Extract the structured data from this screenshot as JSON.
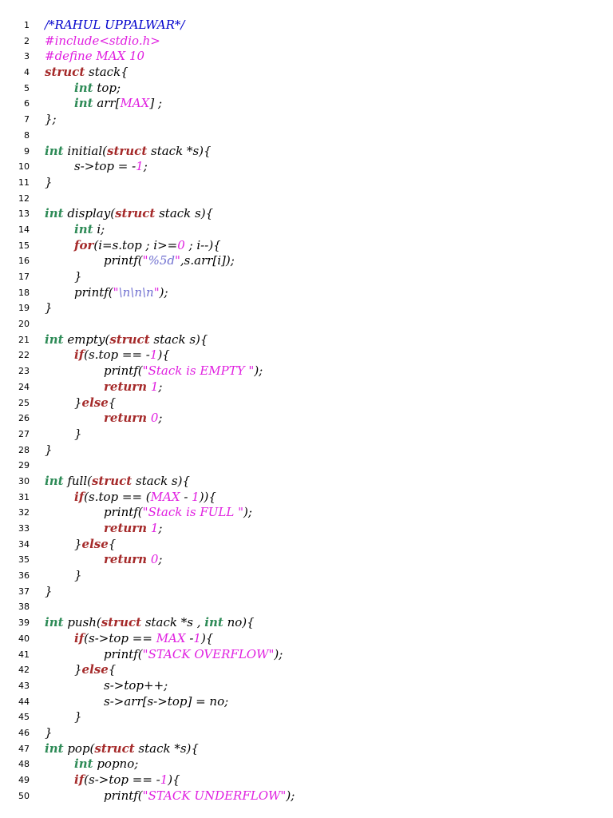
{
  "colors": {
    "background": "#ffffff",
    "line_number": "#000000",
    "plain": "#000000",
    "kw": "#2e8b57",
    "kw2": "#a52a2a",
    "mac": "#e020e0",
    "str": "#e020e0",
    "num": "#e020e0",
    "cmt": "#0000cc",
    "esc": "#7070d0"
  },
  "lines": [
    {
      "n": "1",
      "indent": 0,
      "tokens": [
        [
          "cmt",
          "/*RAHUL UPPALWAR*/"
        ]
      ]
    },
    {
      "n": "2",
      "indent": 0,
      "tokens": [
        [
          "mac",
          "#include<stdio.h>"
        ]
      ]
    },
    {
      "n": "3",
      "indent": 0,
      "tokens": [
        [
          "mac",
          "#define MAX 10"
        ]
      ]
    },
    {
      "n": "4",
      "indent": 0,
      "tokens": [
        [
          "kw2",
          "struct"
        ],
        [
          "p",
          " stack{"
        ]
      ]
    },
    {
      "n": "5",
      "indent": 1,
      "tokens": [
        [
          "kw",
          "int"
        ],
        [
          "p",
          " top;"
        ]
      ]
    },
    {
      "n": "6",
      "indent": 1,
      "tokens": [
        [
          "kw",
          "int"
        ],
        [
          "p",
          " arr["
        ],
        [
          "mac",
          "MAX"
        ],
        [
          "p",
          "] ;"
        ]
      ]
    },
    {
      "n": "7",
      "indent": 0,
      "tokens": [
        [
          "p",
          "};"
        ]
      ]
    },
    {
      "n": "8",
      "indent": 0,
      "tokens": []
    },
    {
      "n": "9",
      "indent": 0,
      "tokens": [
        [
          "kw",
          "int"
        ],
        [
          "p",
          " initial("
        ],
        [
          "kw2",
          "struct"
        ],
        [
          "p",
          " stack *s){"
        ]
      ]
    },
    {
      "n": "10",
      "indent": 1,
      "tokens": [
        [
          "p",
          "s->top = -"
        ],
        [
          "num",
          "1"
        ],
        [
          "p",
          ";"
        ]
      ]
    },
    {
      "n": "11",
      "indent": 0,
      "tokens": [
        [
          "p",
          "}"
        ]
      ]
    },
    {
      "n": "12",
      "indent": 0,
      "tokens": []
    },
    {
      "n": "13",
      "indent": 0,
      "tokens": [
        [
          "kw",
          "int"
        ],
        [
          "p",
          " display("
        ],
        [
          "kw2",
          "struct"
        ],
        [
          "p",
          " stack s){"
        ]
      ]
    },
    {
      "n": "14",
      "indent": 1,
      "tokens": [
        [
          "kw",
          "int"
        ],
        [
          "p",
          " i;"
        ]
      ]
    },
    {
      "n": "15",
      "indent": 1,
      "tokens": [
        [
          "kw2",
          "for"
        ],
        [
          "p",
          "(i=s.top ; i>="
        ],
        [
          "num",
          "0"
        ],
        [
          "p",
          " ; i--){"
        ]
      ]
    },
    {
      "n": "16",
      "indent": 2,
      "tokens": [
        [
          "p",
          "printf("
        ],
        [
          "str",
          "\""
        ],
        [
          "esc",
          "%5d"
        ],
        [
          "str",
          "\""
        ],
        [
          "p",
          ",s.arr[i]);"
        ]
      ]
    },
    {
      "n": "17",
      "indent": 1,
      "tokens": [
        [
          "p",
          "}"
        ]
      ]
    },
    {
      "n": "18",
      "indent": 1,
      "tokens": [
        [
          "p",
          "printf("
        ],
        [
          "str",
          "\""
        ],
        [
          "esc",
          "\\n\\n\\n"
        ],
        [
          "str",
          "\""
        ],
        [
          "p",
          ");"
        ]
      ]
    },
    {
      "n": "19",
      "indent": 0,
      "tokens": [
        [
          "p",
          "}"
        ]
      ]
    },
    {
      "n": "20",
      "indent": 0,
      "tokens": []
    },
    {
      "n": "21",
      "indent": 0,
      "tokens": [
        [
          "kw",
          "int"
        ],
        [
          "p",
          " empty("
        ],
        [
          "kw2",
          "struct"
        ],
        [
          "p",
          " stack s){"
        ]
      ]
    },
    {
      "n": "22",
      "indent": 1,
      "tokens": [
        [
          "kw2",
          "if"
        ],
        [
          "p",
          "(s.top == -"
        ],
        [
          "num",
          "1"
        ],
        [
          "p",
          "){"
        ]
      ]
    },
    {
      "n": "23",
      "indent": 2,
      "tokens": [
        [
          "p",
          "printf("
        ],
        [
          "str",
          "\"Stack is EMPTY \""
        ],
        [
          "p",
          ");"
        ]
      ]
    },
    {
      "n": "24",
      "indent": 2,
      "tokens": [
        [
          "kw2",
          "return"
        ],
        [
          "p",
          " "
        ],
        [
          "num",
          "1"
        ],
        [
          "p",
          ";"
        ]
      ]
    },
    {
      "n": "25",
      "indent": 1,
      "tokens": [
        [
          "p",
          "}"
        ],
        [
          "kw2",
          "else"
        ],
        [
          "p",
          "{"
        ]
      ]
    },
    {
      "n": "26",
      "indent": 2,
      "tokens": [
        [
          "kw2",
          "return"
        ],
        [
          "p",
          " "
        ],
        [
          "num",
          "0"
        ],
        [
          "p",
          ";"
        ]
      ]
    },
    {
      "n": "27",
      "indent": 1,
      "tokens": [
        [
          "p",
          "}"
        ]
      ]
    },
    {
      "n": "28",
      "indent": 0,
      "tokens": [
        [
          "p",
          "}"
        ]
      ]
    },
    {
      "n": "29",
      "indent": 0,
      "tokens": []
    },
    {
      "n": "30",
      "indent": 0,
      "tokens": [
        [
          "kw",
          "int"
        ],
        [
          "p",
          " full("
        ],
        [
          "kw2",
          "struct"
        ],
        [
          "p",
          " stack s){"
        ]
      ]
    },
    {
      "n": "31",
      "indent": 1,
      "tokens": [
        [
          "kw2",
          "if"
        ],
        [
          "p",
          "(s.top == ("
        ],
        [
          "mac",
          "MAX"
        ],
        [
          "p",
          " - "
        ],
        [
          "num",
          "1"
        ],
        [
          "p",
          ")){"
        ]
      ]
    },
    {
      "n": "32",
      "indent": 2,
      "tokens": [
        [
          "p",
          "printf("
        ],
        [
          "str",
          "\"Stack is FULL \""
        ],
        [
          "p",
          ");"
        ]
      ]
    },
    {
      "n": "33",
      "indent": 2,
      "tokens": [
        [
          "kw2",
          "return"
        ],
        [
          "p",
          " "
        ],
        [
          "num",
          "1"
        ],
        [
          "p",
          ";"
        ]
      ]
    },
    {
      "n": "34",
      "indent": 1,
      "tokens": [
        [
          "p",
          "}"
        ],
        [
          "kw2",
          "else"
        ],
        [
          "p",
          "{"
        ]
      ]
    },
    {
      "n": "35",
      "indent": 2,
      "tokens": [
        [
          "kw2",
          "return"
        ],
        [
          "p",
          " "
        ],
        [
          "num",
          "0"
        ],
        [
          "p",
          ";"
        ]
      ]
    },
    {
      "n": "36",
      "indent": 1,
      "tokens": [
        [
          "p",
          "}"
        ]
      ]
    },
    {
      "n": "37",
      "indent": 0,
      "tokens": [
        [
          "p",
          "}"
        ]
      ]
    },
    {
      "n": "38",
      "indent": 0,
      "tokens": []
    },
    {
      "n": "39",
      "indent": 0,
      "tokens": [
        [
          "kw",
          "int"
        ],
        [
          "p",
          " push("
        ],
        [
          "kw2",
          "struct"
        ],
        [
          "p",
          " stack *s , "
        ],
        [
          "kw",
          "int"
        ],
        [
          "p",
          " no){"
        ]
      ]
    },
    {
      "n": "40",
      "indent": 1,
      "tokens": [
        [
          "kw2",
          "if"
        ],
        [
          "p",
          "(s->top == "
        ],
        [
          "mac",
          "MAX"
        ],
        [
          "p",
          " -"
        ],
        [
          "num",
          "1"
        ],
        [
          "p",
          "){"
        ]
      ]
    },
    {
      "n": "41",
      "indent": 2,
      "tokens": [
        [
          "p",
          "printf("
        ],
        [
          "str",
          "\"STACK OVERFLOW\""
        ],
        [
          "p",
          ");"
        ]
      ]
    },
    {
      "n": "42",
      "indent": 1,
      "tokens": [
        [
          "p",
          "}"
        ],
        [
          "kw2",
          "else"
        ],
        [
          "p",
          "{"
        ]
      ]
    },
    {
      "n": "43",
      "indent": 2,
      "tokens": [
        [
          "p",
          "s->top++;"
        ]
      ]
    },
    {
      "n": "44",
      "indent": 2,
      "tokens": [
        [
          "p",
          "s->arr[s->top] = no;"
        ]
      ]
    },
    {
      "n": "45",
      "indent": 1,
      "tokens": [
        [
          "p",
          "}"
        ]
      ]
    },
    {
      "n": "46",
      "indent": 0,
      "tokens": [
        [
          "p",
          "}"
        ]
      ]
    },
    {
      "n": "47",
      "indent": 0,
      "tokens": [
        [
          "kw",
          "int"
        ],
        [
          "p",
          " pop("
        ],
        [
          "kw2",
          "struct"
        ],
        [
          "p",
          " stack *s){"
        ]
      ]
    },
    {
      "n": "48",
      "indent": 1,
      "tokens": [
        [
          "kw",
          "int"
        ],
        [
          "p",
          " popno;"
        ]
      ]
    },
    {
      "n": "49",
      "indent": 1,
      "tokens": [
        [
          "kw2",
          "if"
        ],
        [
          "p",
          "(s->top == -"
        ],
        [
          "num",
          "1"
        ],
        [
          "p",
          "){"
        ]
      ]
    },
    {
      "n": "50",
      "indent": 2,
      "tokens": [
        [
          "p",
          "printf("
        ],
        [
          "str",
          "\"STACK UNDERFLOW\""
        ],
        [
          "p",
          ");"
        ]
      ]
    }
  ]
}
